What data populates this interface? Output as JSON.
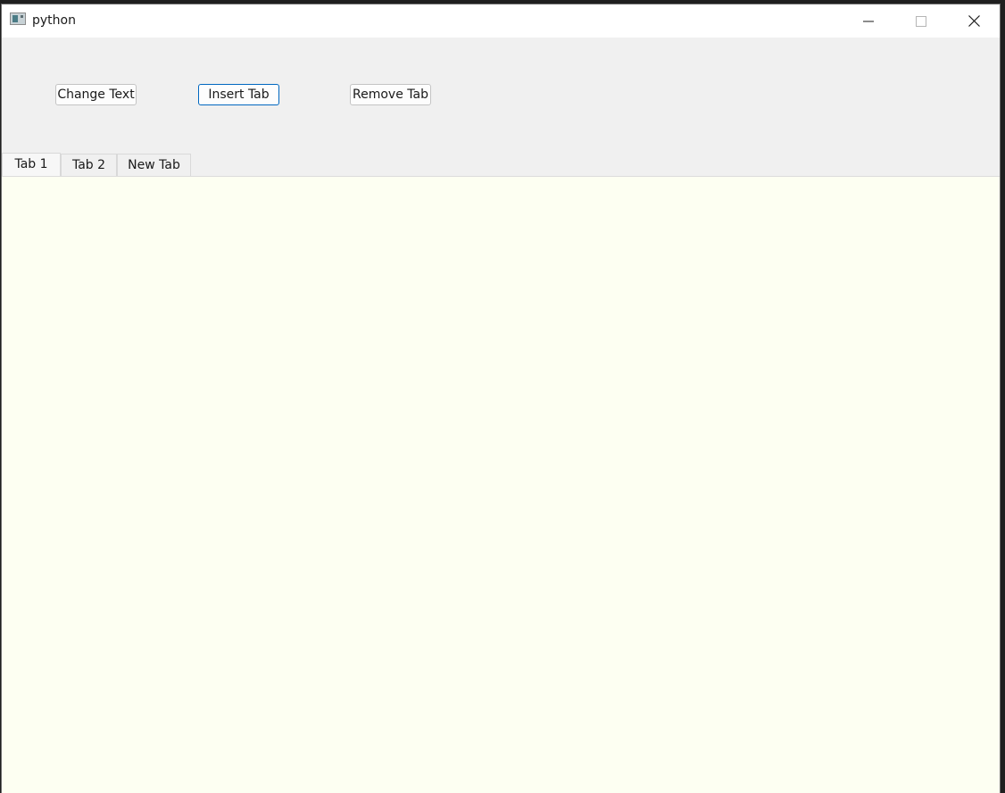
{
  "window": {
    "title": "python",
    "icon": "python-app-icon"
  },
  "caption_buttons": {
    "minimize_icon": "minimize-icon",
    "maximize_icon": "maximize-icon",
    "close_icon": "close-icon"
  },
  "toolbar": {
    "change_text_label": "Change Text",
    "insert_tab_label": "Insert Tab",
    "remove_tab_label": "Remove Tab"
  },
  "tabs": [
    {
      "label": "Tab 1",
      "selected": true
    },
    {
      "label": "Tab 2",
      "selected": false
    },
    {
      "label": "New Tab",
      "selected": false
    }
  ],
  "colors": {
    "pane_background": "#fdfff2",
    "focus_accent": "#0067c0",
    "window_background": "#f0f0f0"
  }
}
